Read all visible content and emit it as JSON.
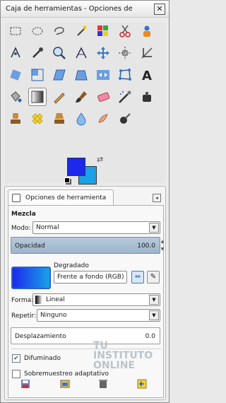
{
  "window": {
    "title": "Caja de herramientas - Opciones de ",
    "close": "✕"
  },
  "tools": [
    "rect-select-icon",
    "ellipse-select-icon",
    "lasso-icon",
    "fuzzy-select-icon",
    "color-select-icon",
    "scissors-icon",
    "foreground-select-icon",
    "paths-icon",
    "color-picker-icon",
    "zoom-icon",
    "measure-icon",
    "move-icon",
    "align-icon",
    "crop-icon",
    "rotate-icon",
    "scale-icon",
    "shear-icon",
    "perspective-icon",
    "flip-icon",
    "cage-transform-icon",
    "text-icon",
    "bucket-fill-icon",
    "blend-icon",
    "pencil-icon",
    "paintbrush-icon",
    "eraser-icon",
    "airbrush-icon",
    "ink-icon",
    "clone-icon",
    "heal-icon",
    "perspective-clone-icon",
    "blur-icon",
    "smudge-icon",
    "dodge-burn-icon"
  ],
  "colors": {
    "foreground": "#1c28ee",
    "background": "#1aa2e6"
  },
  "panel": {
    "tab_label": "Opciones de herramienta",
    "mezcla": "Mezcla",
    "modo_label": "Modo:",
    "modo_value": "Normal",
    "opacidad_label": "Opacidad",
    "opacidad_value": "100.0",
    "degradado_label": "Degradado",
    "degradado_value": "Frente a fondo (RGB)",
    "forma_label": "Forma:",
    "forma_value": "Lineal",
    "repetir_label": "Repetir:",
    "repetir_value": "Ninguno",
    "desplazamiento_label": "Desplazamiento",
    "desplazamiento_value": "0.0",
    "difuminado_label": "Difuminado",
    "difuminado_checked": true,
    "sobremuestreo_label": "Sobremuestreo adaptativo",
    "sobremuestreo_checked": false
  },
  "watermark": [
    "TU",
    "INSTITUTO",
    "ONLINE"
  ],
  "bottom_icons": [
    "save-options-icon",
    "restore-options-icon",
    "delete-options-icon",
    "reset-options-icon"
  ]
}
